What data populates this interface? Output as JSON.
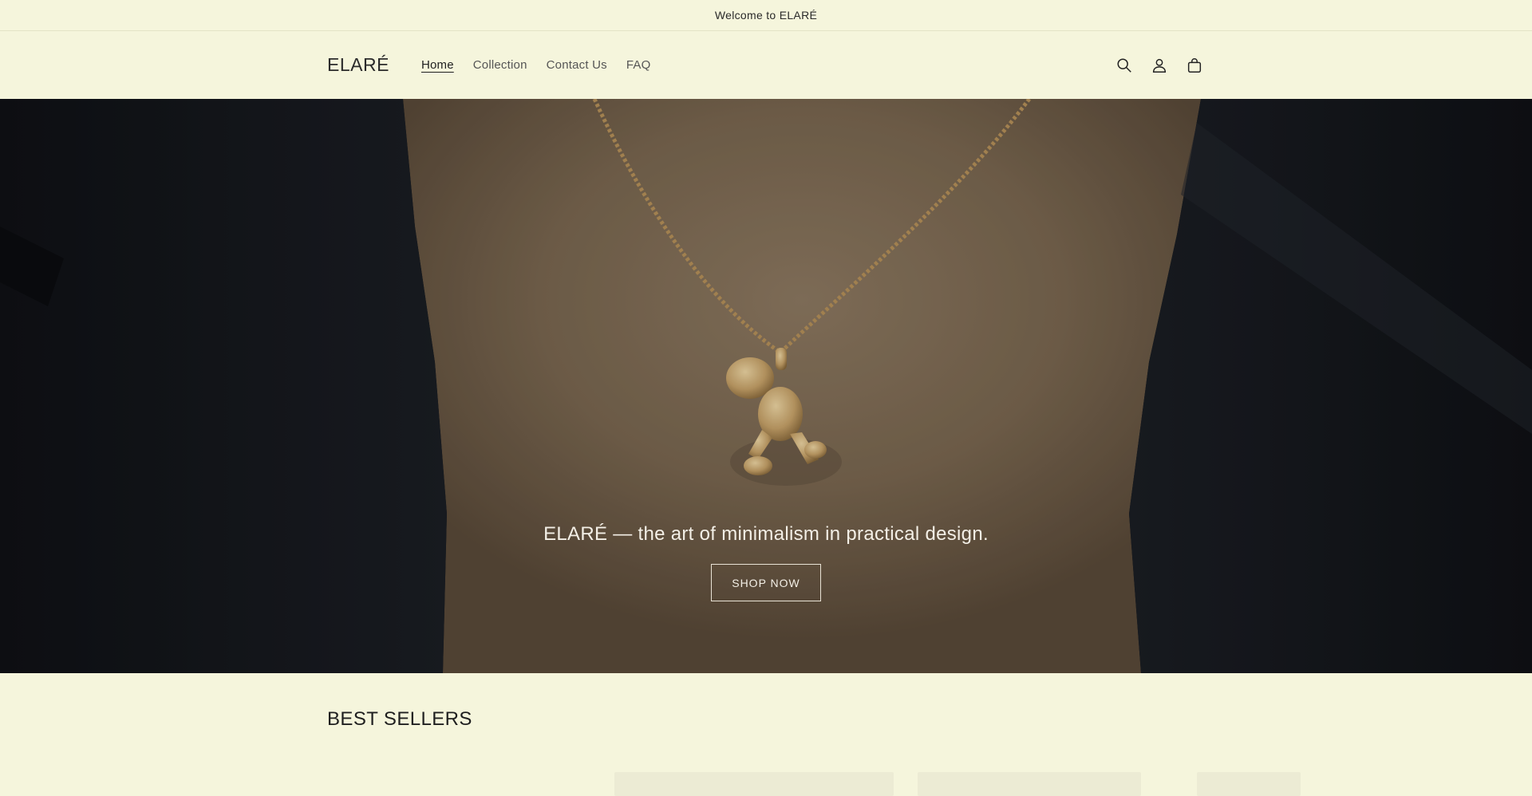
{
  "announcement": {
    "text": "Welcome to ELARÉ"
  },
  "header": {
    "logo": "ELARÉ",
    "nav": [
      {
        "label": "Home",
        "active": true
      },
      {
        "label": "Collection",
        "active": false
      },
      {
        "label": "Contact Us",
        "active": false
      },
      {
        "label": "FAQ",
        "active": false
      }
    ],
    "icons": [
      "search-icon",
      "account-icon",
      "cart-icon"
    ]
  },
  "hero": {
    "heading": "ELARÉ — the art of minimalism in practical design.",
    "button_label": "SHOP NOW"
  },
  "best_sellers": {
    "title": "BEST SELLERS"
  },
  "colors": {
    "background": "#f5f5dc",
    "text": "#1f1f1f",
    "hero_dark": "#14161a",
    "gold": "#c9a46a"
  }
}
